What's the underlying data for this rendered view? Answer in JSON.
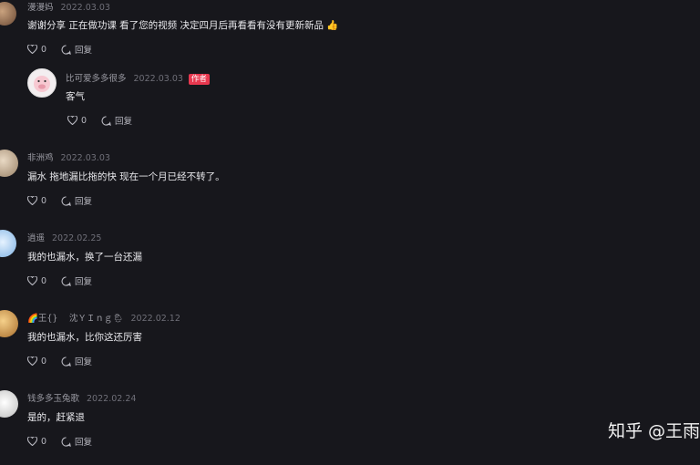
{
  "comments": [
    {
      "name": "漫漫妈",
      "date": "2022.03.03",
      "text": "谢谢分享 正在做功课 看了您的视频 决定四月后再看看有没有更新新品 👍",
      "likes": "0",
      "reply": "回复"
    },
    {
      "name": "比可爱多多很多",
      "date": "2022.03.03",
      "badge": "作者",
      "text": "客气",
      "likes": "0",
      "reply": "回复"
    },
    {
      "name": "非洲鸡",
      "date": "2022.03.03",
      "text": "漏水 拖地漏比拖的快 现在一个月已经不转了。",
      "likes": "0",
      "reply": "回复"
    },
    {
      "name": "逍遥",
      "date": "2022.02.25",
      "text": "我的也漏水，换了一台还漏",
      "likes": "0",
      "reply": "回复"
    },
    {
      "name": "🌈王{} 　沈ＹＩｎｇ🌦",
      "date": "2022.02.12",
      "text": "我的也漏水，比你这还厉害",
      "likes": "0",
      "reply": "回复"
    },
    {
      "name": "钱多多玉兔歌",
      "date": "2022.02.24",
      "text": "是的，赶紧退",
      "likes": "0",
      "reply": "回复"
    }
  ],
  "watermark": "知乎 @王雨",
  "colors": {
    "background": "#17171c",
    "author_badge": "#e8384f"
  }
}
